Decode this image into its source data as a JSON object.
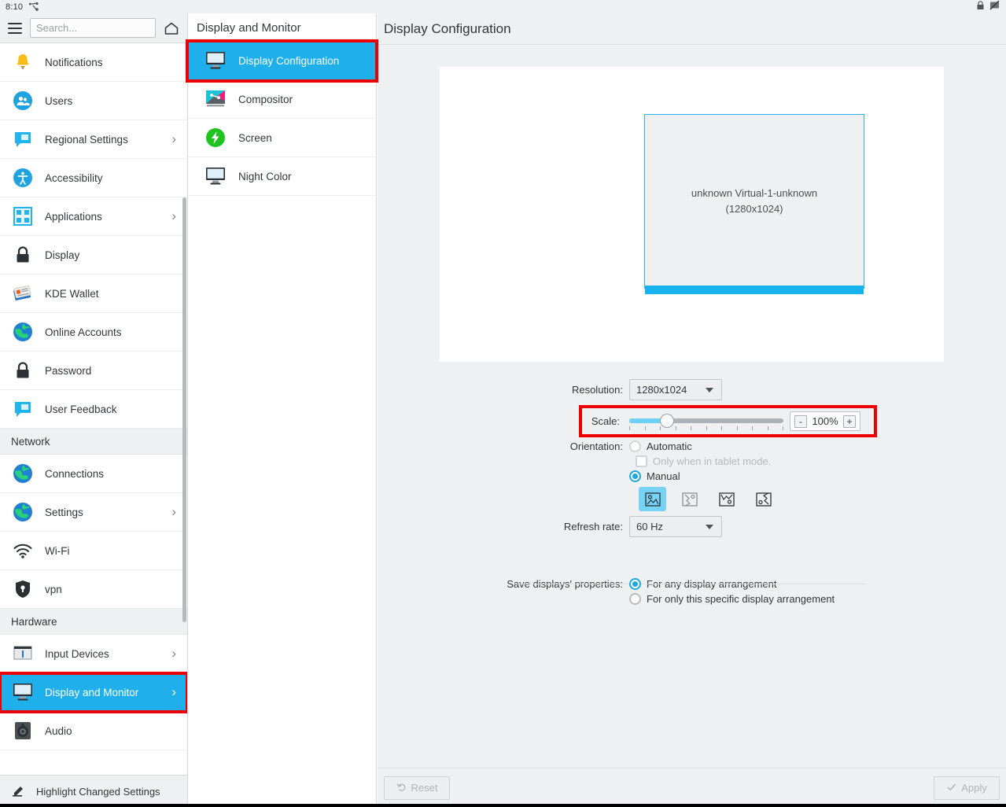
{
  "sysbar": {
    "clock": "8:10",
    "network_icon": "network-icon",
    "lock_icon": "lock-icon",
    "display_off_icon": "display-off-icon"
  },
  "sidebar": {
    "menu_icon": "hamburger-menu-icon",
    "home_icon": "home-icon",
    "search": {
      "value": "",
      "placeholder": "Search..."
    },
    "footer": {
      "label": "Highlight Changed Settings",
      "icon": "highlighter-icon"
    },
    "items": [
      {
        "label": "Notifications",
        "icon": "bell-icon",
        "chevron": false,
        "selected": false,
        "type": "item"
      },
      {
        "label": "Users",
        "icon": "users-icon",
        "chevron": false,
        "selected": false,
        "type": "item"
      },
      {
        "label": "Regional Settings",
        "icon": "speech-bubble-icon",
        "chevron": true,
        "selected": false,
        "type": "item"
      },
      {
        "label": "Accessibility",
        "icon": "accessibility-icon",
        "chevron": false,
        "selected": false,
        "type": "item"
      },
      {
        "label": "Applications",
        "icon": "grid-apps-icon",
        "chevron": true,
        "selected": false,
        "type": "item"
      },
      {
        "label": "Display",
        "icon": "lock-icon",
        "chevron": false,
        "selected": false,
        "type": "item"
      },
      {
        "label": "KDE Wallet",
        "icon": "wallet-icon",
        "chevron": false,
        "selected": false,
        "type": "item"
      },
      {
        "label": "Online Accounts",
        "icon": "globe-icon",
        "chevron": false,
        "selected": false,
        "type": "item"
      },
      {
        "label": "Password",
        "icon": "lock-icon",
        "chevron": false,
        "selected": false,
        "type": "item"
      },
      {
        "label": "User Feedback",
        "icon": "speech-bubble-icon",
        "chevron": false,
        "selected": false,
        "type": "item"
      },
      {
        "label": "Network",
        "icon": "",
        "chevron": false,
        "selected": false,
        "type": "section"
      },
      {
        "label": "Connections",
        "icon": "globe-icon",
        "chevron": false,
        "selected": false,
        "type": "item"
      },
      {
        "label": "Settings",
        "icon": "globe-icon",
        "chevron": true,
        "selected": false,
        "type": "item"
      },
      {
        "label": "Wi-Fi",
        "icon": "wifi-icon",
        "chevron": false,
        "selected": false,
        "type": "item"
      },
      {
        "label": "vpn",
        "icon": "shield-key-icon",
        "chevron": false,
        "selected": false,
        "type": "item"
      },
      {
        "label": "Hardware",
        "icon": "",
        "chevron": false,
        "selected": false,
        "type": "section"
      },
      {
        "label": "Input Devices",
        "icon": "input-device-icon",
        "chevron": true,
        "selected": false,
        "type": "item"
      },
      {
        "label": "Display and Monitor",
        "icon": "monitor-icon",
        "chevron": true,
        "selected": true,
        "type": "item",
        "highlighted": true
      },
      {
        "label": "Audio",
        "icon": "speaker-icon",
        "chevron": false,
        "selected": false,
        "type": "item"
      }
    ]
  },
  "midcol": {
    "title": "Display and Monitor",
    "items": [
      {
        "label": "Display Configuration",
        "icon": "monitor-icon",
        "selected": true,
        "highlighted": true
      },
      {
        "label": "Compositor",
        "icon": "compositor-icon",
        "selected": false,
        "highlighted": false
      },
      {
        "label": "Screen",
        "icon": "energy-icon",
        "selected": false,
        "highlighted": false
      },
      {
        "label": "Night Color",
        "icon": "monitor-icon",
        "selected": false,
        "highlighted": false
      }
    ]
  },
  "main": {
    "title": "Display Configuration",
    "preview": {
      "display_name": "unknown Virtual-1-unknown",
      "display_resolution": "(1280x1024)"
    },
    "resolution": {
      "label": "Resolution:",
      "value": "1280x1024",
      "dropdown_icon": "chevron-down-icon"
    },
    "scale": {
      "label": "Scale:",
      "value": "100%",
      "minus_label": "-",
      "plus_label": "+",
      "slider_percent": 20,
      "highlighted": true
    },
    "orientation": {
      "label": "Orientation:",
      "automatic_label": "Automatic",
      "automatic_selected": false,
      "automatic_disabled": true,
      "tablet_label": "Only when in tablet mode.",
      "tablet_checked": false,
      "tablet_disabled": true,
      "manual_label": "Manual",
      "manual_selected": true,
      "icons": [
        {
          "name": "orientation-landscape-icon",
          "selected": true
        },
        {
          "name": "orientation-portrait-icon",
          "selected": false
        },
        {
          "name": "orientation-landscape-flipped-icon",
          "selected": false
        },
        {
          "name": "orientation-portrait-flipped-icon",
          "selected": false
        }
      ]
    },
    "refresh_rate": {
      "label": "Refresh rate:",
      "value": "60 Hz",
      "dropdown_icon": "chevron-down-icon"
    },
    "save_properties": {
      "label": "Save displays' properties:",
      "options": [
        {
          "label": "For any display arrangement",
          "selected": true
        },
        {
          "label": "For only this specific display arrangement",
          "selected": false
        }
      ]
    },
    "footer": {
      "reset_label": "Reset",
      "reset_icon": "undo-icon",
      "apply_label": "Apply",
      "apply_icon": "check-icon"
    }
  },
  "colors": {
    "accent": "#1fb0ec",
    "highlight_box": "#ee0000",
    "panel_bg": "#eff0f1",
    "text": "#31363b"
  }
}
